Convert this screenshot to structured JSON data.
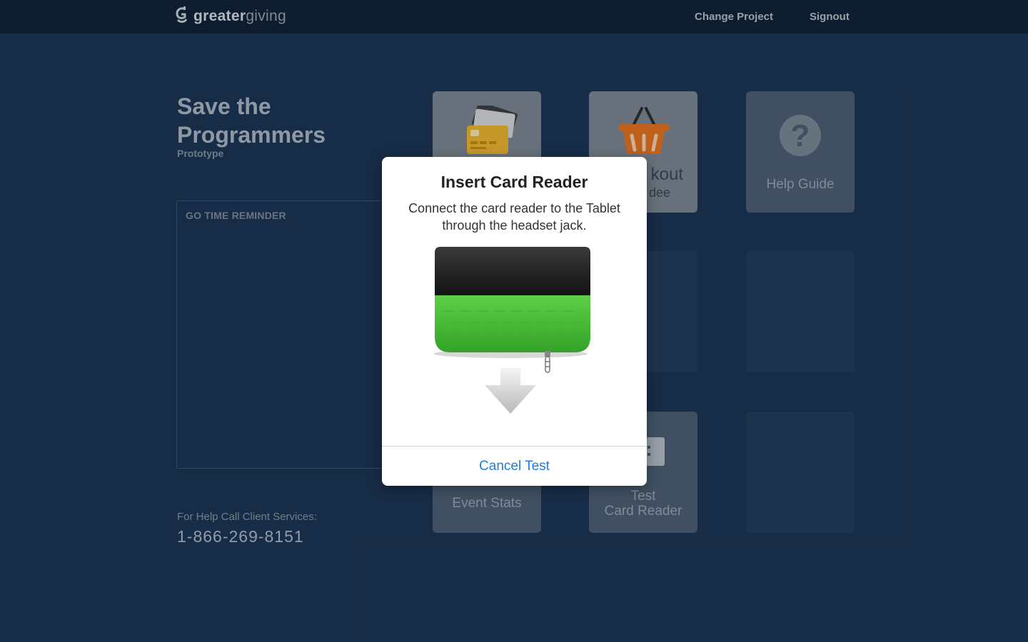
{
  "app": {
    "logo_bold": "greater",
    "logo_light": "giving"
  },
  "nav": {
    "change_project": "Change Project",
    "signout": "Signout"
  },
  "project": {
    "title": "Save the Programmers",
    "subtitle": "Prototype"
  },
  "reminder": {
    "label": "GO TIME REMINDER"
  },
  "help": {
    "label": "For Help Call Client Services:",
    "phone": "1-866-269-8151"
  },
  "tiles": {
    "checkout_partial": "kout",
    "checkout_partial_line2": "dee",
    "help_guide": "Help Guide",
    "event_stats": "Event Stats",
    "test_card_reader_line1": "Test",
    "test_card_reader_line2": "Card Reader"
  },
  "modal": {
    "title": "Insert Card Reader",
    "message": "Connect the card reader to the Tablet through the headset jack.",
    "cancel": "Cancel Test"
  },
  "colors": {
    "background": "#1b3350",
    "topbar": "#0f1f33",
    "accent_link": "#1f7fe0",
    "reader_green": "#4bbf3a",
    "basket_orange": "#e8731c",
    "card_yellow": "#f0b62e"
  }
}
